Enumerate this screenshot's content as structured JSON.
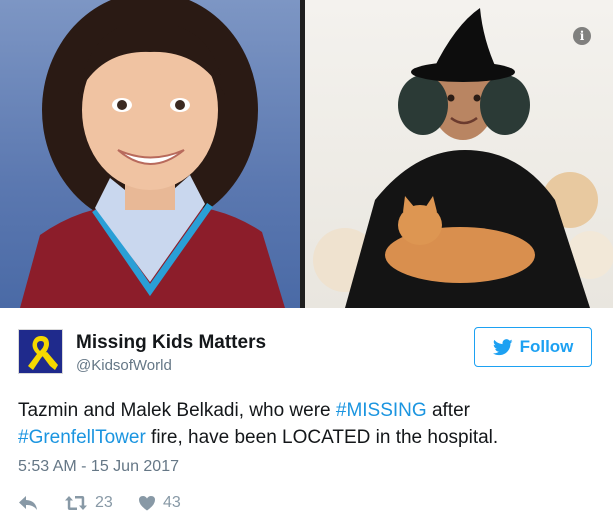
{
  "media": {
    "info_icon": "info-icon",
    "info_glyph": "i"
  },
  "author": {
    "display_name": "Missing Kids Matters",
    "handle": "@KidsofWorld",
    "avatar_icon": "yellow-ribbon-icon"
  },
  "follow_button": {
    "label": "Follow",
    "icon": "twitter-bird-icon"
  },
  "tweet": {
    "text_parts": {
      "p1": "Tazmin and Malek Belkadi, who were ",
      "tag1": "#MISSING",
      "p2": " after",
      "tag2": "#GrenfellTower",
      "p3": " fire, have been LOCATED in the hospital."
    },
    "timestamp": "5:53 AM - 15 Jun 2017"
  },
  "actions": {
    "reply_icon": "reply-icon",
    "retweet_icon": "retweet-icon",
    "retweet_count": "23",
    "like_icon": "heart-icon",
    "like_count": "43"
  },
  "colors": {
    "link": "#1b95e0",
    "follow": "#1da1f2",
    "muted": "#657786",
    "avatar_bg": "#1f2a8c",
    "ribbon": "#f5d800"
  }
}
